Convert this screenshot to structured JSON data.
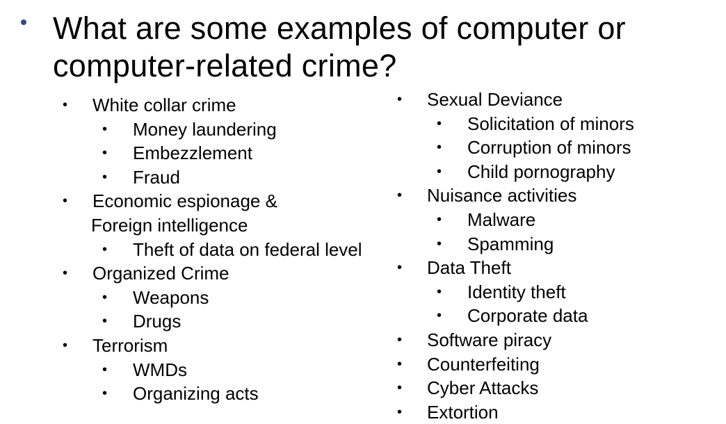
{
  "slide": {
    "title": "What are some examples of computer or computer-related crime?"
  },
  "left_column": [
    {
      "label": "White collar crime",
      "level": 1
    },
    {
      "label": "Money laundering",
      "level": 2
    },
    {
      "label": "Embezzlement",
      "level": 2
    },
    {
      "label": "Fraud",
      "level": 2
    },
    {
      "label": "Economic espionage &",
      "level": 1
    },
    {
      "label": "Foreign intelligence",
      "level": 1,
      "continuation": true
    },
    {
      "label": "Theft of data on federal level",
      "level": 2
    },
    {
      "label": "Organized Crime",
      "level": 1
    },
    {
      "label": "Weapons",
      "level": 2
    },
    {
      "label": "Drugs",
      "level": 2
    },
    {
      "label": "Terrorism",
      "level": 1
    },
    {
      "label": "WMDs",
      "level": 2
    },
    {
      "label": "Organizing acts",
      "level": 2
    }
  ],
  "right_column": [
    {
      "label": "Sexual Deviance",
      "level": 1
    },
    {
      "label": "Solicitation of minors",
      "level": 2
    },
    {
      "label": "Corruption of minors",
      "level": 2
    },
    {
      "label": "Child pornography",
      "level": 2
    },
    {
      "label": "Nuisance activities",
      "level": 1
    },
    {
      "label": "Malware",
      "level": 2
    },
    {
      "label": "Spamming",
      "level": 2
    },
    {
      "label": "Data Theft",
      "level": 1
    },
    {
      "label": "Identity theft",
      "level": 2
    },
    {
      "label": "Corporate data",
      "level": 2
    },
    {
      "label": "Software piracy",
      "level": 1
    },
    {
      "label": "Counterfeiting",
      "level": 1
    },
    {
      "label": "Cyber Attacks",
      "level": 1
    },
    {
      "label": "Extortion",
      "level": 1
    }
  ],
  "colors": {
    "title_bullet": "#2e4a8a",
    "text": "#000000",
    "background": "#ffffff"
  }
}
